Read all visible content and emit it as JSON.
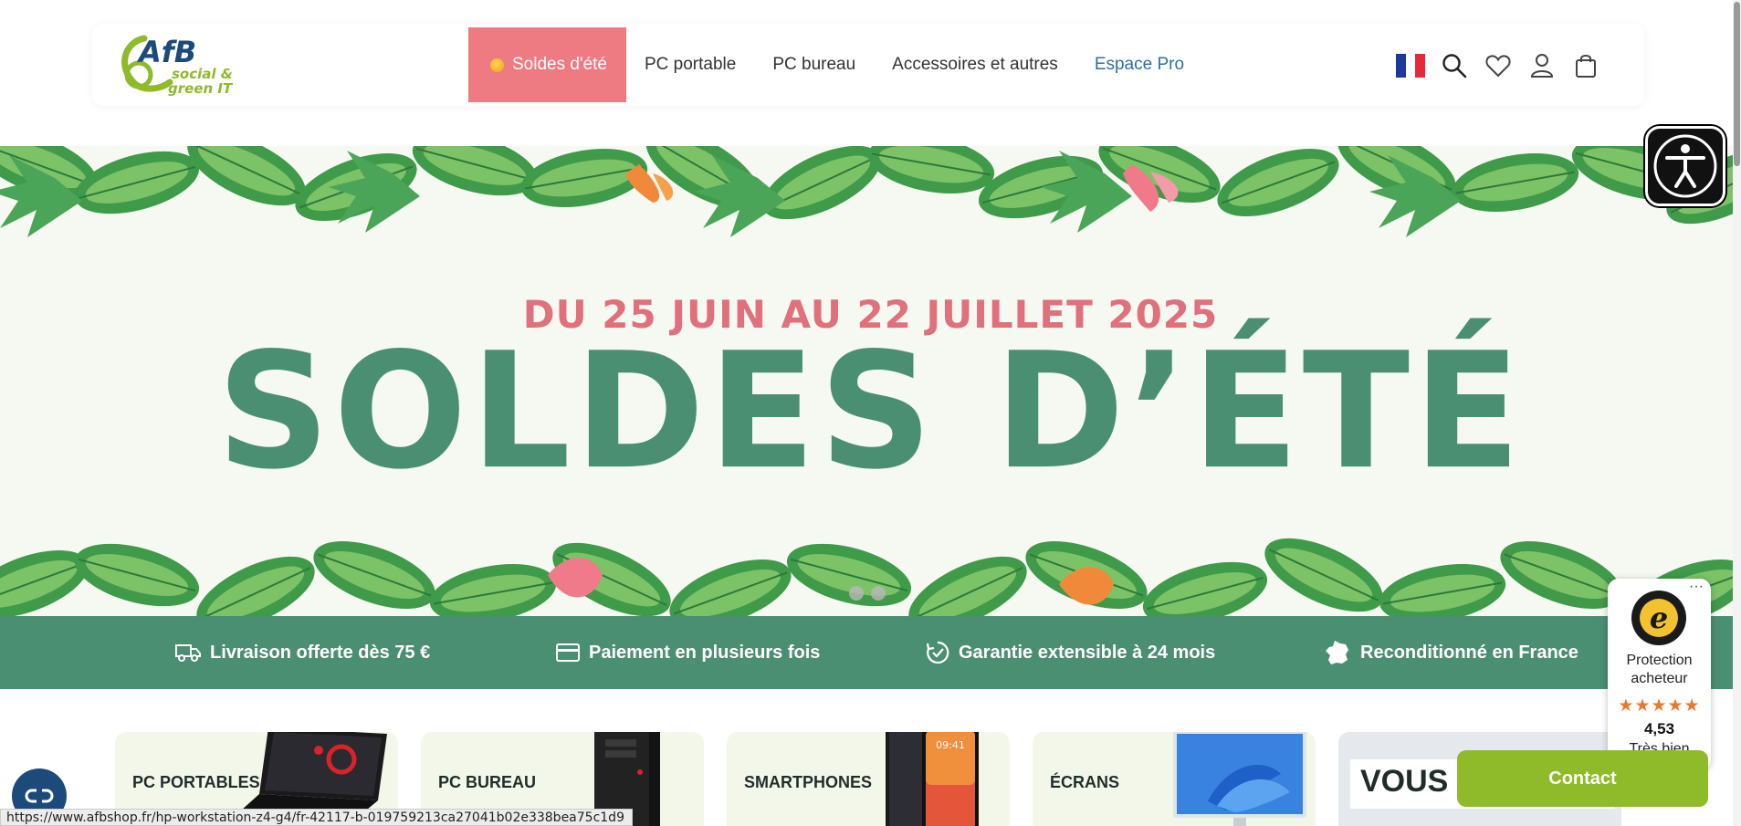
{
  "header": {
    "logo_alt": "AfB social & green IT",
    "logo_main": "AfB",
    "logo_sub1": "social &",
    "logo_sub2": "green IT",
    "nav": [
      {
        "label": "Soldes d'été"
      },
      {
        "label": "PC portable"
      },
      {
        "label": "PC bureau"
      },
      {
        "label": "Accessoires et autres"
      },
      {
        "label": "Espace Pro"
      }
    ],
    "icons": [
      "flag-fr-icon",
      "search-icon",
      "heart-icon",
      "user-icon",
      "cart-icon"
    ]
  },
  "hero": {
    "date_line": "DU 25 JUIN AU 22 JUILLET 2025",
    "title": "SOLDES D’ÉTÉ",
    "slides": 2,
    "active_slide": 1
  },
  "features": [
    {
      "icon": "truck-icon",
      "label": "Livraison offerte dès 75 €"
    },
    {
      "icon": "credit-card-icon",
      "label": "Paiement en plusieurs fois"
    },
    {
      "icon": "warranty-icon",
      "label": "Garantie extensible à 24 mois"
    },
    {
      "icon": "france-map-icon",
      "label": "Reconditionné en France"
    }
  ],
  "categories": [
    {
      "label": "PC PORTABLES"
    },
    {
      "label": "PC BUREAU"
    },
    {
      "label": "SMARTPHONES"
    },
    {
      "label": "ÉCRANS"
    },
    {
      "label": "VOUS Ê"
    }
  ],
  "phone_time": "09:41",
  "trusted_shops": {
    "more": "···",
    "line1": "Protection",
    "line2": "acheteur",
    "stars": "★★★★★",
    "rating": 4.53,
    "score": "4,53",
    "label": "Très bien"
  },
  "contact_label": "Contact",
  "status_url": "https://www.afbshop.fr/hp-workstation-z4-g4/fr-42117-b-019759213ca27041b02e338bea75c1d9",
  "colors": {
    "accent_green": "#4b8f73",
    "sale_pink": "#ef7b82",
    "date_pink": "#e0707b",
    "contact_green": "#8fba2a",
    "pro_blue": "#2d6ea6"
  }
}
